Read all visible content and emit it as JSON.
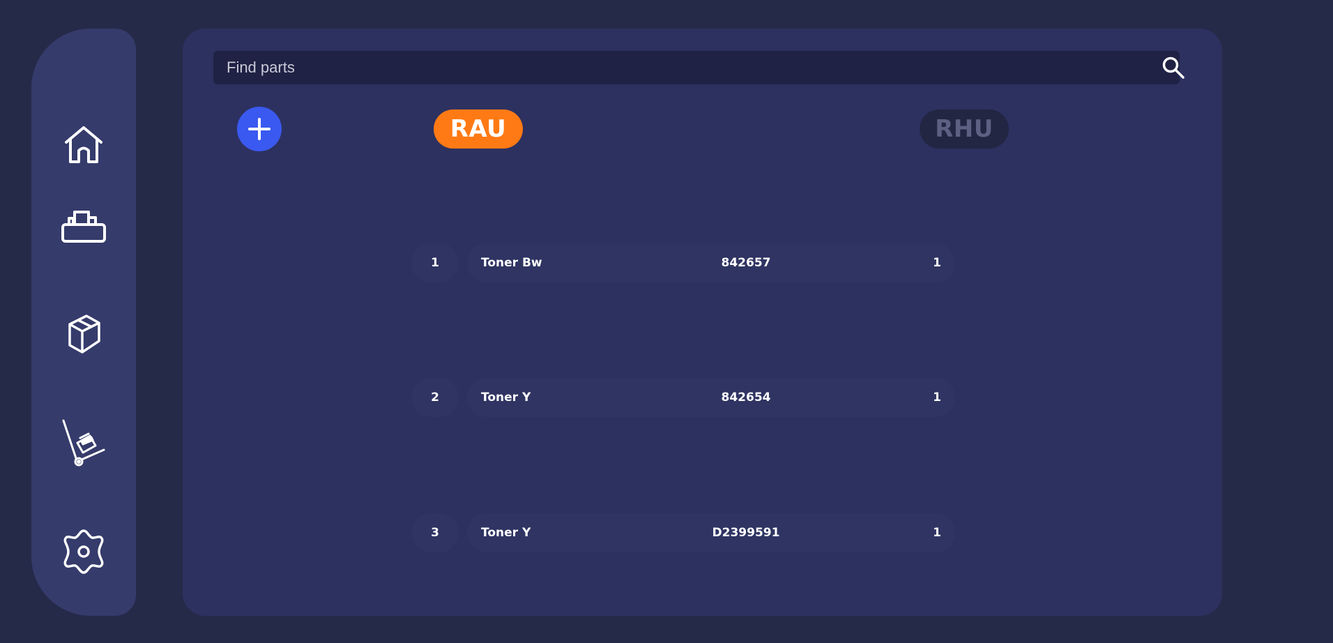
{
  "sidebar": {
    "items": [
      {
        "icon": "home-icon",
        "label": "Home"
      },
      {
        "icon": "printer-icon",
        "label": "Printers"
      },
      {
        "icon": "box-icon",
        "label": "Parts"
      },
      {
        "icon": "hand-truck-icon",
        "label": "Delivery"
      },
      {
        "icon": "gear-icon",
        "label": "Settings"
      }
    ]
  },
  "search": {
    "placeholder": "Find parts",
    "value": "",
    "icon": "search-icon"
  },
  "add_button": {
    "icon": "plus-icon"
  },
  "tabs": [
    {
      "label": "RAU",
      "active": true,
      "color": "#ff7a14"
    },
    {
      "label": "RHU",
      "active": false,
      "color": "#232643"
    }
  ],
  "parts": [
    {
      "index": "1",
      "name": "Toner Bw",
      "code": "842657",
      "qty": "1"
    },
    {
      "index": "2",
      "name": "Toner Y",
      "code": "842654",
      "qty": "1"
    },
    {
      "index": "3",
      "name": "Toner Y",
      "code": "D2399591",
      "qty": "1"
    }
  ],
  "colors": {
    "background": "#262a49",
    "sidebar": "#353b6b",
    "panel": "#2d3160",
    "accent_blue": "#3a59f0",
    "accent_orange": "#ff7a14"
  }
}
